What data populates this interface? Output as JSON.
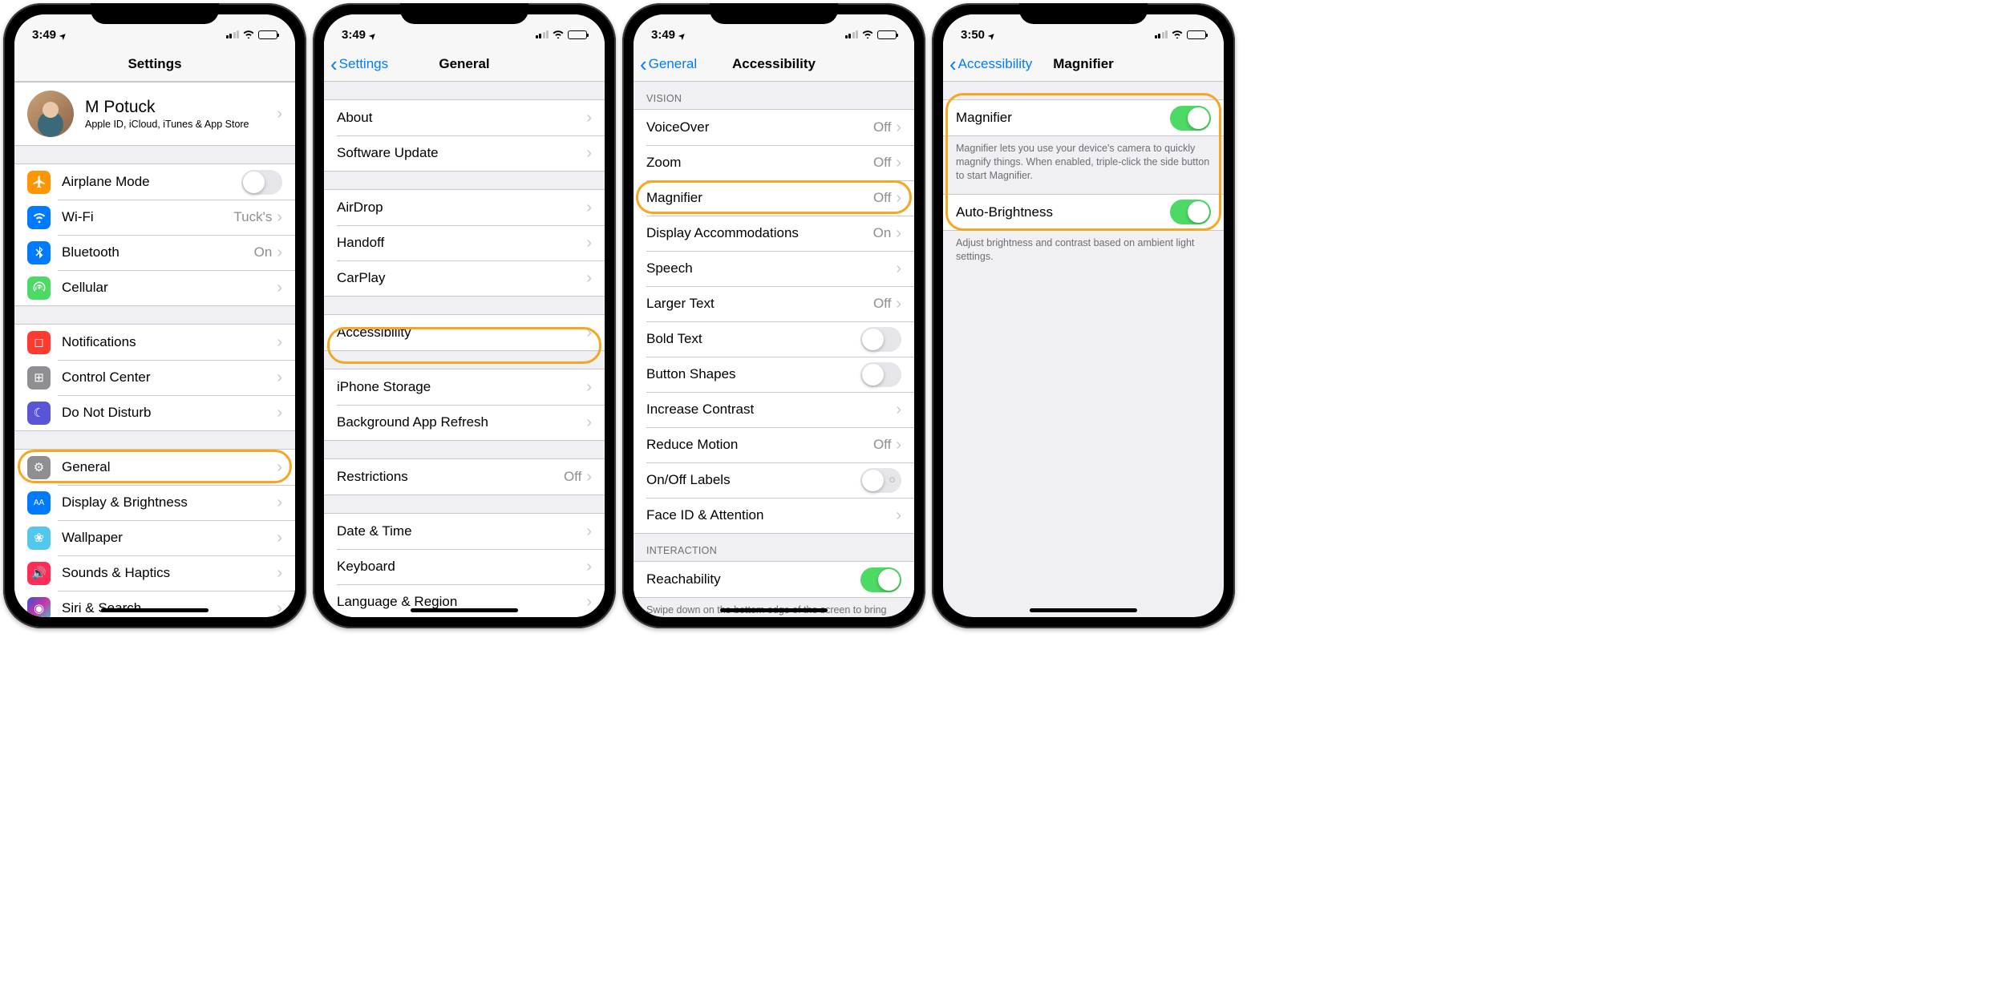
{
  "status": {
    "time_a": "3:49",
    "time_d": "3:50"
  },
  "s1": {
    "title": "Settings",
    "profile": {
      "name": "M Potuck",
      "sub": "Apple ID, iCloud, iTunes & App Store"
    },
    "airplane": "Airplane Mode",
    "wifi": {
      "label": "Wi-Fi",
      "value": "Tuck's"
    },
    "bluetooth": {
      "label": "Bluetooth",
      "value": "On"
    },
    "cellular": "Cellular",
    "notifications": "Notifications",
    "control_center": "Control Center",
    "dnd": "Do Not Disturb",
    "general": "General",
    "display": "Display & Brightness",
    "wallpaper": "Wallpaper",
    "sounds": "Sounds & Haptics",
    "siri": "Siri & Search"
  },
  "s2": {
    "back": "Settings",
    "title": "General",
    "about": "About",
    "software": "Software Update",
    "airdrop": "AirDrop",
    "handoff": "Handoff",
    "carplay": "CarPlay",
    "accessibility": "Accessibility",
    "storage": "iPhone Storage",
    "bgapp": "Background App Refresh",
    "restrictions": {
      "label": "Restrictions",
      "value": "Off"
    },
    "datetime": "Date & Time",
    "keyboard": "Keyboard",
    "language": "Language & Region"
  },
  "s3": {
    "back": "General",
    "title": "Accessibility",
    "section_vision": "Vision",
    "voiceover": {
      "label": "VoiceOver",
      "value": "Off"
    },
    "zoom": {
      "label": "Zoom",
      "value": "Off"
    },
    "magnifier": {
      "label": "Magnifier",
      "value": "Off"
    },
    "display_accom": {
      "label": "Display Accommodations",
      "value": "On"
    },
    "speech": "Speech",
    "larger_text": {
      "label": "Larger Text",
      "value": "Off"
    },
    "bold": "Bold Text",
    "button_shapes": "Button Shapes",
    "increase_contrast": "Increase Contrast",
    "reduce_motion": {
      "label": "Reduce Motion",
      "value": "Off"
    },
    "onoff": "On/Off Labels",
    "faceid": "Face ID & Attention",
    "section_interaction": "Interaction",
    "reachability": "Reachability",
    "reach_footer": "Swipe down on the bottom edge of the screen to bring the top into reach."
  },
  "s4": {
    "back": "Accessibility",
    "title": "Magnifier",
    "magnifier": "Magnifier",
    "magnifier_footer": "Magnifier lets you use your device's camera to quickly magnify things. When enabled, triple-click the side button to start Magnifier.",
    "auto_brightness": "Auto-Brightness",
    "ab_footer": "Adjust brightness and contrast based on ambient light settings."
  },
  "colors": {
    "airplane": "#ff9500",
    "wifi": "#007aff",
    "bluetooth": "#007aff",
    "cellular": "#4cd964",
    "notifications": "#ff3b30",
    "control": "#8e8e93",
    "dnd": "#5856d6",
    "general": "#8e8e93",
    "display": "#007aff",
    "wallpaper": "#54c7ec",
    "sounds": "#ff2d55",
    "siri": "#222"
  }
}
